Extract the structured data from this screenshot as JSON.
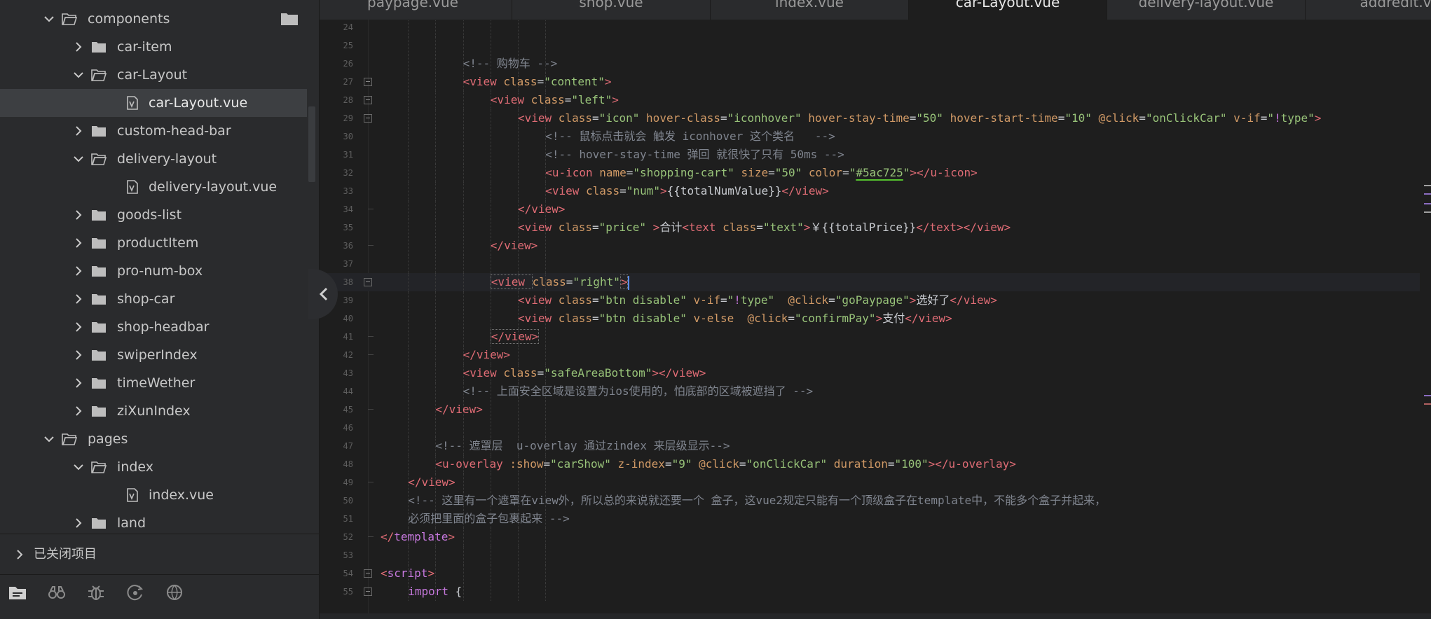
{
  "sidebar": {
    "tree": [
      {
        "label": "components",
        "depth": 0,
        "type": "folder",
        "expanded": true
      },
      {
        "label": "car-item",
        "depth": 1,
        "type": "folder",
        "expanded": false
      },
      {
        "label": "car-Layout",
        "depth": 1,
        "type": "folder",
        "expanded": true
      },
      {
        "label": "car-Layout.vue",
        "depth": 2,
        "type": "file",
        "selected": true
      },
      {
        "label": "custom-head-bar",
        "depth": 1,
        "type": "folder",
        "expanded": false
      },
      {
        "label": "delivery-layout",
        "depth": 1,
        "type": "folder",
        "expanded": true
      },
      {
        "label": "delivery-layout.vue",
        "depth": 2,
        "type": "file"
      },
      {
        "label": "goods-list",
        "depth": 1,
        "type": "folder",
        "expanded": false
      },
      {
        "label": "productItem",
        "depth": 1,
        "type": "folder",
        "expanded": false
      },
      {
        "label": "pro-num-box",
        "depth": 1,
        "type": "folder",
        "expanded": false
      },
      {
        "label": "shop-car",
        "depth": 1,
        "type": "folder",
        "expanded": false
      },
      {
        "label": "shop-headbar",
        "depth": 1,
        "type": "folder",
        "expanded": false
      },
      {
        "label": "swiperIndex",
        "depth": 1,
        "type": "folder",
        "expanded": false
      },
      {
        "label": "timeWether",
        "depth": 1,
        "type": "folder",
        "expanded": false
      },
      {
        "label": "ziXunIndex",
        "depth": 1,
        "type": "folder",
        "expanded": false
      },
      {
        "label": "pages",
        "depth": 0,
        "type": "folder",
        "expanded": true
      },
      {
        "label": "index",
        "depth": 1,
        "type": "folder",
        "expanded": true
      },
      {
        "label": "index.vue",
        "depth": 2,
        "type": "file"
      },
      {
        "label": "land",
        "depth": 1,
        "type": "folder",
        "expanded": false
      }
    ],
    "closed_projects": "已关闭项目",
    "tools": [
      "explorer-icon",
      "binoculars-icon",
      "bug-icon",
      "git-icon",
      "browser-icon"
    ]
  },
  "tabs": [
    {
      "label": "paypage.vue",
      "active": false
    },
    {
      "label": "shop.vue",
      "active": false
    },
    {
      "label": "index.vue",
      "active": false
    },
    {
      "label": "car-Layout.vue",
      "active": true
    },
    {
      "label": "delivery-layout.vue",
      "active": false
    },
    {
      "label": "addredit.vue",
      "active": false
    }
  ],
  "editor": {
    "current_line": 38,
    "lines": [
      {
        "n": 24,
        "indent": 0,
        "parts": []
      },
      {
        "n": 25,
        "indent": 0,
        "parts": []
      },
      {
        "n": 26,
        "indent": 3,
        "parts": [
          [
            "cm",
            "<!-- 购物车 -->"
          ]
        ]
      },
      {
        "n": 27,
        "indent": 3,
        "fold": "open",
        "parts": [
          [
            "tg",
            "<view "
          ],
          [
            "at",
            "class"
          ],
          [
            "tx",
            "="
          ],
          [
            "st",
            "\"content\""
          ],
          [
            "tg",
            ">"
          ]
        ]
      },
      {
        "n": 28,
        "indent": 4,
        "fold": "open",
        "parts": [
          [
            "tg",
            "<view "
          ],
          [
            "at",
            "class"
          ],
          [
            "tx",
            "="
          ],
          [
            "st",
            "\"left\""
          ],
          [
            "tg",
            ">"
          ]
        ]
      },
      {
        "n": 29,
        "indent": 5,
        "fold": "open",
        "parts": [
          [
            "tg",
            "<view "
          ],
          [
            "at",
            "class"
          ],
          [
            "tx",
            "="
          ],
          [
            "st",
            "\"icon\" "
          ],
          [
            "at",
            "hover-class"
          ],
          [
            "tx",
            "="
          ],
          [
            "st",
            "\"iconhover\" "
          ],
          [
            "at",
            "hover-stay-time"
          ],
          [
            "tx",
            "="
          ],
          [
            "st",
            "\"50\" "
          ],
          [
            "at",
            "hover-start-time"
          ],
          [
            "tx",
            "="
          ],
          [
            "st",
            "\"10\" "
          ],
          [
            "at",
            "@click"
          ],
          [
            "tx",
            "="
          ],
          [
            "st",
            "\"onClickCar\" "
          ],
          [
            "at",
            "v-if"
          ],
          [
            "tx",
            "="
          ],
          [
            "st",
            "\""
          ],
          [
            "kw",
            "!"
          ],
          [
            "st",
            "type\""
          ],
          [
            "tg",
            ">"
          ]
        ]
      },
      {
        "n": 30,
        "indent": 6,
        "parts": [
          [
            "cm",
            "<!-- 鼠标点击就会 触发 iconhover 这个类名   -->"
          ]
        ]
      },
      {
        "n": 31,
        "indent": 6,
        "parts": [
          [
            "cm",
            "<!-- hover-stay-time 弹回 就很快了只有 50ms -->"
          ]
        ]
      },
      {
        "n": 32,
        "indent": 6,
        "parts": [
          [
            "tg",
            "<u-icon "
          ],
          [
            "at",
            "name"
          ],
          [
            "tx",
            "="
          ],
          [
            "st",
            "\"shopping-cart\" "
          ],
          [
            "at",
            "size"
          ],
          [
            "tx",
            "="
          ],
          [
            "st",
            "\"50\" "
          ],
          [
            "at",
            "color"
          ],
          [
            "tx",
            "="
          ],
          [
            "st",
            "\""
          ],
          [
            "sq",
            "#5ac725"
          ],
          [
            "st",
            "\""
          ],
          [
            "tg",
            "></u-icon>"
          ]
        ]
      },
      {
        "n": 33,
        "indent": 6,
        "parts": [
          [
            "tg",
            "<view "
          ],
          [
            "at",
            "class"
          ],
          [
            "tx",
            "="
          ],
          [
            "st",
            "\"num\""
          ],
          [
            "tg",
            ">"
          ],
          [
            "tx",
            "{{totalNumValue}}"
          ],
          [
            "tg",
            "</view>"
          ]
        ]
      },
      {
        "n": 34,
        "indent": 5,
        "fold": "end",
        "parts": [
          [
            "tg",
            "</view>"
          ]
        ]
      },
      {
        "n": 35,
        "indent": 5,
        "parts": [
          [
            "tg",
            "<view "
          ],
          [
            "at",
            "class"
          ],
          [
            "tx",
            "="
          ],
          [
            "st",
            "\"price\" "
          ],
          [
            "tg",
            ">"
          ],
          [
            "tx",
            "合计"
          ],
          [
            "tg",
            "<text "
          ],
          [
            "at",
            "class"
          ],
          [
            "tx",
            "="
          ],
          [
            "st",
            "\"text\""
          ],
          [
            "tg",
            ">"
          ],
          [
            "tx",
            "￥{{totalPrice}}"
          ],
          [
            "tg",
            "</text></view>"
          ]
        ]
      },
      {
        "n": 36,
        "indent": 4,
        "fold": "end",
        "parts": [
          [
            "tg",
            "</view>"
          ]
        ]
      },
      {
        "n": 37,
        "indent": 0,
        "parts": []
      },
      {
        "n": 38,
        "indent": 4,
        "fold": "open",
        "parts": [
          [
            "tgbox",
            "<view "
          ],
          [
            "at",
            "class"
          ],
          [
            "tx",
            "="
          ],
          [
            "st",
            "\"right\""
          ],
          [
            "tgbox",
            ">"
          ],
          [
            "cursor",
            ""
          ]
        ]
      },
      {
        "n": 39,
        "indent": 5,
        "parts": [
          [
            "tg",
            "<view "
          ],
          [
            "at",
            "class"
          ],
          [
            "tx",
            "="
          ],
          [
            "st",
            "\"btn disable\" "
          ],
          [
            "at",
            "v-if"
          ],
          [
            "tx",
            "="
          ],
          [
            "st",
            "\""
          ],
          [
            "kw",
            "!"
          ],
          [
            "st",
            "type\"  "
          ],
          [
            "at",
            "@click"
          ],
          [
            "tx",
            "="
          ],
          [
            "st",
            "\"goPaypage\""
          ],
          [
            "tg",
            ">"
          ],
          [
            "tx",
            "选好了"
          ],
          [
            "tg",
            "</view>"
          ]
        ]
      },
      {
        "n": 40,
        "indent": 5,
        "parts": [
          [
            "tg",
            "<view "
          ],
          [
            "at",
            "class"
          ],
          [
            "tx",
            "="
          ],
          [
            "st",
            "\"btn disable\" "
          ],
          [
            "at",
            "v-else  @click"
          ],
          [
            "tx",
            "="
          ],
          [
            "st",
            "\"confirmPay\""
          ],
          [
            "tg",
            ">"
          ],
          [
            "tx",
            "支付"
          ],
          [
            "tg",
            "</view>"
          ]
        ]
      },
      {
        "n": 41,
        "indent": 4,
        "fold": "end",
        "parts": [
          [
            "tgbox",
            "</view>"
          ]
        ]
      },
      {
        "n": 42,
        "indent": 3,
        "fold": "end",
        "parts": [
          [
            "tg",
            "</view>"
          ]
        ]
      },
      {
        "n": 43,
        "indent": 3,
        "parts": [
          [
            "tg",
            "<view "
          ],
          [
            "at",
            "class"
          ],
          [
            "tx",
            "="
          ],
          [
            "st",
            "\"safeAreaBottom\""
          ],
          [
            "tg",
            "></view>"
          ]
        ]
      },
      {
        "n": 44,
        "indent": 3,
        "parts": [
          [
            "cm",
            "<!-- 上面安全区域是设置为ios使用的，怕底部的区域被遮挡了 -->"
          ]
        ]
      },
      {
        "n": 45,
        "indent": 2,
        "fold": "end",
        "parts": [
          [
            "tg",
            "</view>"
          ]
        ]
      },
      {
        "n": 46,
        "indent": 0,
        "parts": []
      },
      {
        "n": 47,
        "indent": 2,
        "parts": [
          [
            "cm",
            "<!-- 遮罩层  u-overlay 通过zindex 来层级显示-->"
          ]
        ]
      },
      {
        "n": 48,
        "indent": 2,
        "parts": [
          [
            "tg",
            "<u-overlay "
          ],
          [
            "at",
            ":show"
          ],
          [
            "tx",
            "="
          ],
          [
            "st",
            "\"carShow\" "
          ],
          [
            "at",
            "z-index"
          ],
          [
            "tx",
            "="
          ],
          [
            "st",
            "\"9\" "
          ],
          [
            "at",
            "@click"
          ],
          [
            "tx",
            "="
          ],
          [
            "st",
            "\"onClickCar\" "
          ],
          [
            "at",
            "duration"
          ],
          [
            "tx",
            "="
          ],
          [
            "st",
            "\"100\""
          ],
          [
            "tg",
            "></u-overlay>"
          ]
        ]
      },
      {
        "n": 49,
        "indent": 1,
        "fold": "end",
        "parts": [
          [
            "tg",
            "</view>"
          ]
        ]
      },
      {
        "n": 50,
        "indent": 1,
        "parts": [
          [
            "cm",
            "<!-- 这里有一个遮罩在view外，所以总的来说就还要一个 盒子，这vue2规定只能有一个顶级盒子在template中，不能多个盒子并起来，"
          ]
        ]
      },
      {
        "n": 51,
        "indent": 1,
        "parts": [
          [
            "cm",
            "必须把里面的盒子包裹起来 -->"
          ]
        ]
      },
      {
        "n": 52,
        "indent": 0,
        "fold": "end",
        "parts": [
          [
            "tg",
            "</"
          ],
          [
            "kw",
            "template"
          ],
          [
            "tg",
            ">"
          ]
        ]
      },
      {
        "n": 53,
        "indent": 0,
        "parts": []
      },
      {
        "n": 54,
        "indent": 0,
        "fold": "open",
        "parts": [
          [
            "tg",
            "<"
          ],
          [
            "kw",
            "script"
          ],
          [
            "tg",
            ">"
          ]
        ]
      },
      {
        "n": 55,
        "indent": 1,
        "fold": "open",
        "parts": [
          [
            "kw",
            "import "
          ],
          [
            "tx",
            "{"
          ]
        ]
      }
    ]
  },
  "colors": {
    "tag": "#e06c75",
    "attr": "#d19a66",
    "string": "#98c379",
    "comment": "#7f848e",
    "text": "#c9ccd1",
    "keyword": "#c678dd",
    "squiggle": "#55c22e"
  }
}
